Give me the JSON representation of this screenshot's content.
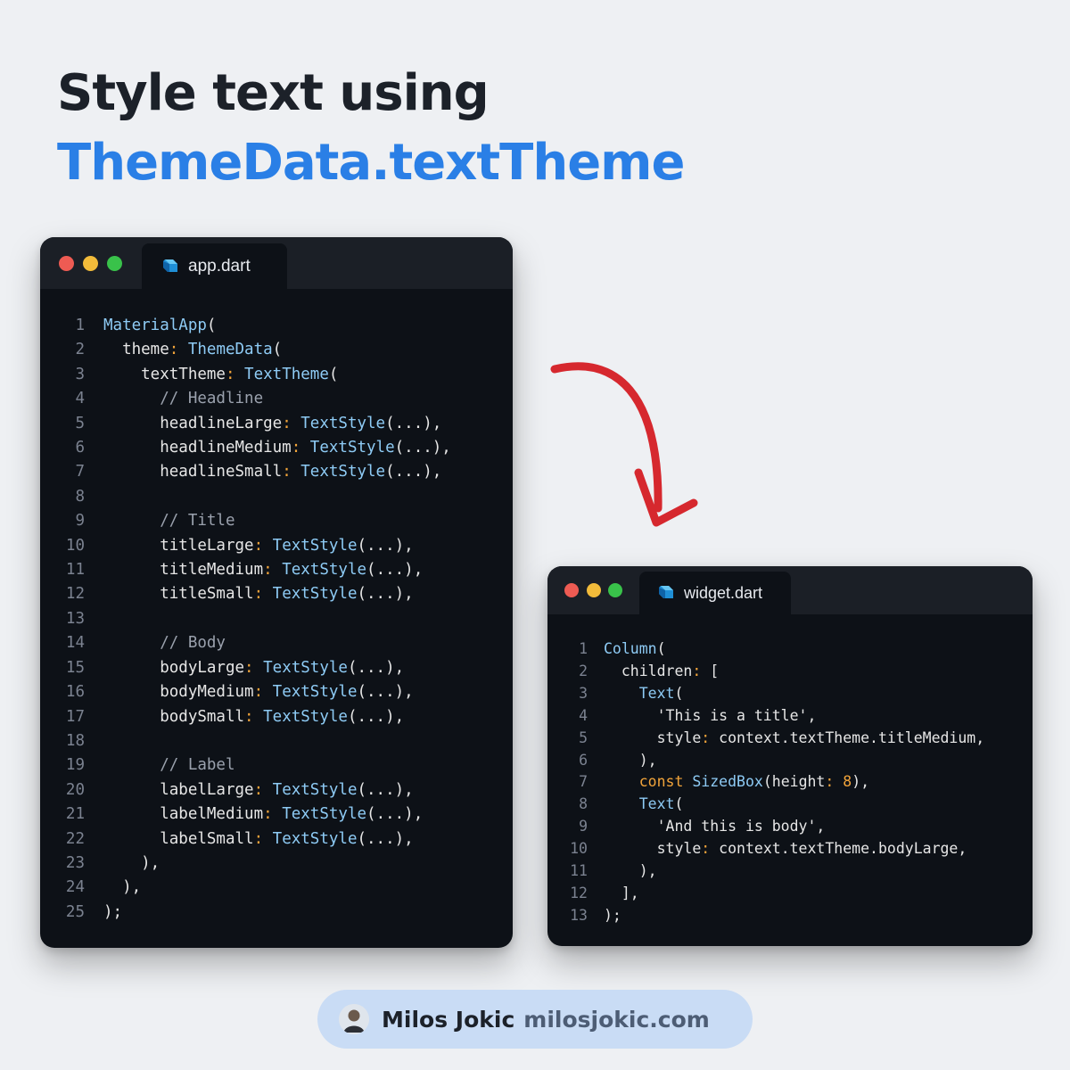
{
  "heading": {
    "line1": "Style text using",
    "line2": "ThemeData.textTheme"
  },
  "colors": {
    "heading_dark": "#1c2129",
    "heading_accent": "#2a7fe6",
    "arrow": "#d6282e",
    "pill_bg": "#c9dcf5"
  },
  "windows": [
    {
      "tab_label": "app.dart",
      "tab_icon": "dart-icon",
      "lines": [
        [
          [
            "cls",
            "MaterialApp"
          ],
          [
            "punc",
            "("
          ]
        ],
        [
          [
            "prop",
            "  theme"
          ],
          [
            "colon",
            ": "
          ],
          [
            "cls",
            "ThemeData"
          ],
          [
            "punc",
            "("
          ]
        ],
        [
          [
            "prop",
            "    textTheme"
          ],
          [
            "colon",
            ": "
          ],
          [
            "cls",
            "TextTheme"
          ],
          [
            "punc",
            "("
          ]
        ],
        [
          [
            "cmt",
            "      // Headline"
          ]
        ],
        [
          [
            "prop",
            "      headlineLarge"
          ],
          [
            "colon",
            ": "
          ],
          [
            "cls",
            "TextStyle"
          ],
          [
            "punc",
            "(...),"
          ]
        ],
        [
          [
            "prop",
            "      headlineMedium"
          ],
          [
            "colon",
            ": "
          ],
          [
            "cls",
            "TextStyle"
          ],
          [
            "punc",
            "(...),"
          ]
        ],
        [
          [
            "prop",
            "      headlineSmall"
          ],
          [
            "colon",
            ": "
          ],
          [
            "cls",
            "TextStyle"
          ],
          [
            "punc",
            "(...),"
          ]
        ],
        [],
        [
          [
            "cmt",
            "      // Title"
          ]
        ],
        [
          [
            "prop",
            "      titleLarge"
          ],
          [
            "colon",
            ": "
          ],
          [
            "cls",
            "TextStyle"
          ],
          [
            "punc",
            "(...),"
          ]
        ],
        [
          [
            "prop",
            "      titleMedium"
          ],
          [
            "colon",
            ": "
          ],
          [
            "cls",
            "TextStyle"
          ],
          [
            "punc",
            "(...),"
          ]
        ],
        [
          [
            "prop",
            "      titleSmall"
          ],
          [
            "colon",
            ": "
          ],
          [
            "cls",
            "TextStyle"
          ],
          [
            "punc",
            "(...),"
          ]
        ],
        [],
        [
          [
            "cmt",
            "      // Body"
          ]
        ],
        [
          [
            "prop",
            "      bodyLarge"
          ],
          [
            "colon",
            ": "
          ],
          [
            "cls",
            "TextStyle"
          ],
          [
            "punc",
            "(...),"
          ]
        ],
        [
          [
            "prop",
            "      bodyMedium"
          ],
          [
            "colon",
            ": "
          ],
          [
            "cls",
            "TextStyle"
          ],
          [
            "punc",
            "(...),"
          ]
        ],
        [
          [
            "prop",
            "      bodySmall"
          ],
          [
            "colon",
            ": "
          ],
          [
            "cls",
            "TextStyle"
          ],
          [
            "punc",
            "(...),"
          ]
        ],
        [],
        [
          [
            "cmt",
            "      // Label"
          ]
        ],
        [
          [
            "prop",
            "      labelLarge"
          ],
          [
            "colon",
            ": "
          ],
          [
            "cls",
            "TextStyle"
          ],
          [
            "punc",
            "(...),"
          ]
        ],
        [
          [
            "prop",
            "      labelMedium"
          ],
          [
            "colon",
            ": "
          ],
          [
            "cls",
            "TextStyle"
          ],
          [
            "punc",
            "(...),"
          ]
        ],
        [
          [
            "prop",
            "      labelSmall"
          ],
          [
            "colon",
            ": "
          ],
          [
            "cls",
            "TextStyle"
          ],
          [
            "punc",
            "(...),"
          ]
        ],
        [
          [
            "punc",
            "    ),"
          ]
        ],
        [
          [
            "punc",
            "  ),"
          ]
        ],
        [
          [
            "punc",
            ");"
          ]
        ]
      ]
    },
    {
      "tab_label": "widget.dart",
      "tab_icon": "dart-icon",
      "lines": [
        [
          [
            "cls",
            "Column"
          ],
          [
            "punc",
            "("
          ]
        ],
        [
          [
            "prop",
            "  children"
          ],
          [
            "colon",
            ": "
          ],
          [
            "punc",
            "["
          ]
        ],
        [
          [
            "cls",
            "    Text"
          ],
          [
            "punc",
            "("
          ]
        ],
        [
          [
            "str",
            "      'This is a title'"
          ],
          [
            "punc",
            ","
          ]
        ],
        [
          [
            "prop",
            "      style"
          ],
          [
            "colon",
            ": "
          ],
          [
            "prop",
            "context.textTheme.titleMedium"
          ],
          [
            "punc",
            ","
          ]
        ],
        [
          [
            "punc",
            "    ),"
          ]
        ],
        [
          [
            "kw",
            "    const "
          ],
          [
            "cls",
            "SizedBox"
          ],
          [
            "punc",
            "(height"
          ],
          [
            "colon",
            ": "
          ],
          [
            "num",
            "8"
          ],
          [
            "punc",
            "),"
          ]
        ],
        [
          [
            "cls",
            "    Text"
          ],
          [
            "punc",
            "("
          ]
        ],
        [
          [
            "str",
            "      'And this is body'"
          ],
          [
            "punc",
            ","
          ]
        ],
        [
          [
            "prop",
            "      style"
          ],
          [
            "colon",
            ": "
          ],
          [
            "prop",
            "context.textTheme.bodyLarge"
          ],
          [
            "punc",
            ","
          ]
        ],
        [
          [
            "punc",
            "    ),"
          ]
        ],
        [
          [
            "punc",
            "  ],"
          ]
        ],
        [
          [
            "punc",
            ");"
          ]
        ]
      ]
    }
  ],
  "footer": {
    "avatar_icon": "avatar",
    "author": "Milos Jokic",
    "site": "milosjokic.com"
  }
}
